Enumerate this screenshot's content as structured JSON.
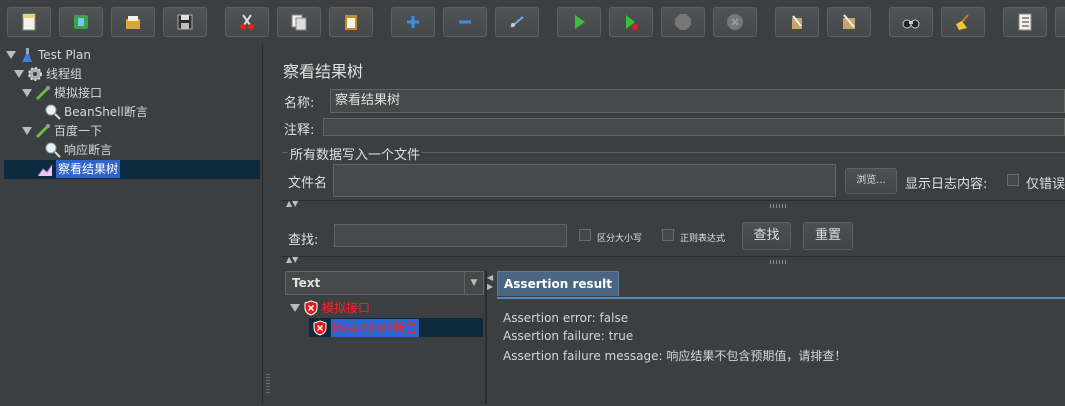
{
  "toolbar": {
    "buttons": [
      {
        "name": "new-icon"
      },
      {
        "name": "templates-icon"
      },
      {
        "name": "open-icon"
      },
      {
        "name": "save-icon"
      },
      {
        "name": "cut-icon"
      },
      {
        "name": "copy-icon"
      },
      {
        "name": "paste-icon"
      },
      {
        "name": "expand-all-icon"
      },
      {
        "name": "collapse-all-icon"
      },
      {
        "name": "toggle-icon"
      },
      {
        "name": "start-icon"
      },
      {
        "name": "start-no-pause-icon"
      },
      {
        "name": "stop-icon"
      },
      {
        "name": "shutdown-icon"
      },
      {
        "name": "clear-icon"
      },
      {
        "name": "clear-all-icon"
      },
      {
        "name": "search-icon"
      },
      {
        "name": "reset-search-icon"
      },
      {
        "name": "function-helper-icon"
      }
    ]
  },
  "tree": {
    "test_plan": "Test Plan",
    "thread_group": "线程组",
    "sampler1": "模拟接口",
    "assert1": "BeanShell断言",
    "sampler2": "百度一下",
    "assert2": "响应断言",
    "listener": "察看结果树"
  },
  "panel": {
    "title": "察看结果树",
    "name_label": "名称:",
    "name_value": "察看结果树",
    "comment_label": "注释:",
    "group_title": "所有数据写入一个文件",
    "filename_label": "文件名",
    "browse_button": "浏览...",
    "log_label": "显示日志内容:",
    "errors_only_label": "仅错误"
  },
  "search": {
    "label": "查找:",
    "case_label": "区分大小写",
    "regex_label": "正则表达式",
    "find_button": "查找",
    "reset_button": "重置"
  },
  "results": {
    "renderer_selected": "Text",
    "items": [
      {
        "label": "模拟接口",
        "status": "fail"
      },
      {
        "label": "BeanShell断言",
        "status": "fail"
      }
    ]
  },
  "assertion_tab": {
    "tab_label": "Assertion result",
    "lines": [
      "Assertion error: false",
      "Assertion failure: true",
      "Assertion failure message: 响应结果不包含预期值，请排查！"
    ]
  },
  "colors": {
    "error_red": "#ff2020",
    "selection_blue": "#2f65ca",
    "tab_blue": "#4a6781"
  }
}
